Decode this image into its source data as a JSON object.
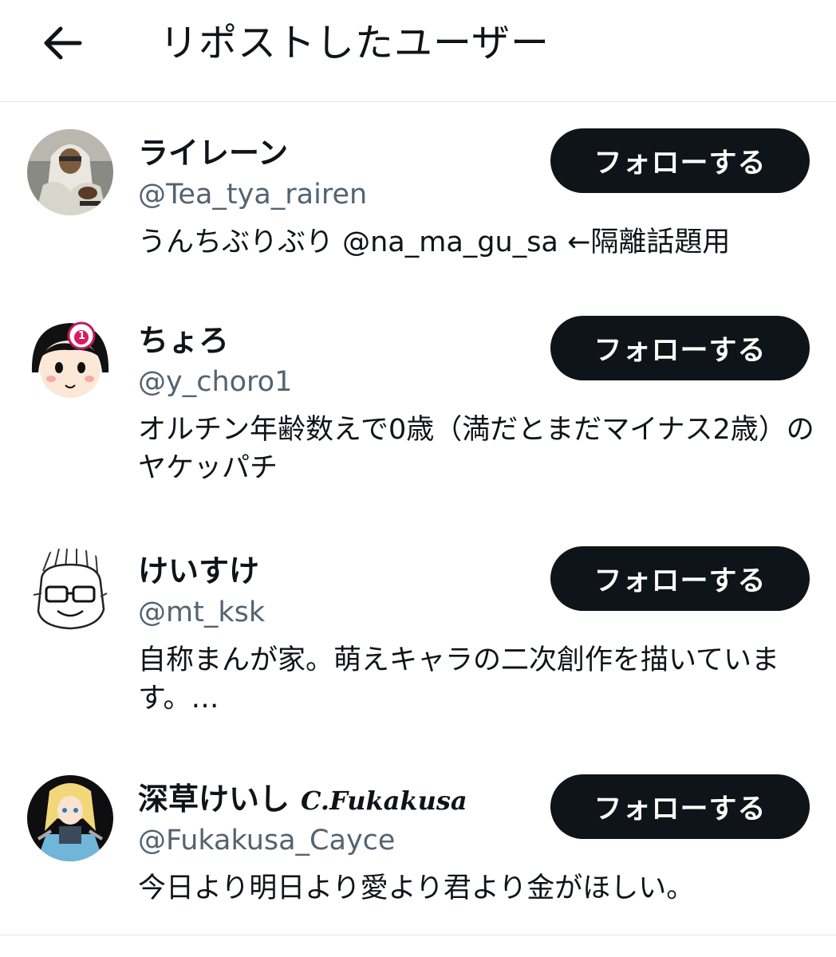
{
  "header": {
    "title": "リポストしたユーザー",
    "back_icon": "arrow-left-icon"
  },
  "users": [
    {
      "display_name": "ライレーン",
      "handle": "@Tea_tya_rairen",
      "bio": "うんちぶりぶり @na_ma_gu_sa ←隔離話題用",
      "follow_label": "フォローする"
    },
    {
      "display_name": "ちょろ",
      "handle": "@y_choro1",
      "bio": "オルチン年齢数えで0歳（満だとまだマイナス2歳）のヤケッパチ",
      "avatar_badge": "1",
      "follow_label": "フォローする"
    },
    {
      "display_name": "けいすけ",
      "handle": "@mt_ksk",
      "bio": "自称まんが家。萌えキャラの二次創作を描いています。…",
      "follow_label": "フォローする"
    },
    {
      "display_name": "深草けいし",
      "display_name_logo": "C.Fukakusa",
      "handle": "@Fukakusa_Cayce",
      "bio": "今日より明日より愛より君より金がほしい。",
      "follow_label": "フォローする"
    }
  ],
  "colors": {
    "primary_text": "#0f1419",
    "secondary_text": "#536471",
    "button_bg": "#0f1419",
    "button_text": "#ffffff",
    "divider": "#e1e4e8"
  }
}
